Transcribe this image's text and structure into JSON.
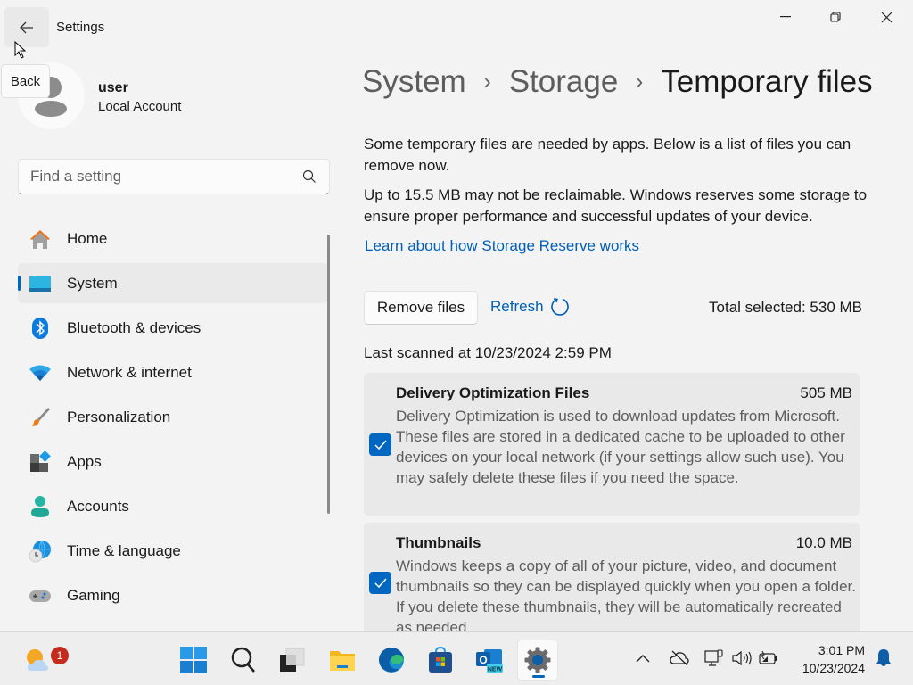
{
  "window": {
    "title": "Settings",
    "back_tooltip": "Back",
    "controls": [
      "minimize",
      "restore",
      "close"
    ]
  },
  "profile": {
    "name": "user",
    "account_type": "Local Account"
  },
  "search": {
    "placeholder": "Find a setting",
    "value": ""
  },
  "nav": {
    "items": [
      {
        "label": "Home",
        "icon": "home-icon"
      },
      {
        "label": "System",
        "icon": "system-icon",
        "active": true
      },
      {
        "label": "Bluetooth & devices",
        "icon": "bluetooth-icon"
      },
      {
        "label": "Network & internet",
        "icon": "wifi-icon"
      },
      {
        "label": "Personalization",
        "icon": "paintbrush-icon"
      },
      {
        "label": "Apps",
        "icon": "apps-icon"
      },
      {
        "label": "Accounts",
        "icon": "accounts-icon"
      },
      {
        "label": "Time & language",
        "icon": "time-language-icon"
      },
      {
        "label": "Gaming",
        "icon": "gaming-icon"
      }
    ]
  },
  "breadcrumb": {
    "items": [
      "System",
      "Storage"
    ],
    "current": "Temporary files",
    "separator": "›"
  },
  "main": {
    "intro": "Some temporary files are needed by apps. Below is a list of files you can remove now.",
    "reserve_note": "Up to 15.5 MB may not be reclaimable. Windows reserves some storage to ensure proper performance and successful updates of your device.",
    "reserve_link": "Learn about how Storage Reserve works",
    "remove_button": "Remove files",
    "refresh_button": "Refresh",
    "total_selected": "Total selected: 530 MB",
    "last_scanned": "Last scanned at 10/23/2024 2:59 PM",
    "categories": [
      {
        "title": "Delivery Optimization Files",
        "size": "505 MB",
        "checked": true,
        "description": "Delivery Optimization is used to download updates from Microsoft. These files are stored in a dedicated cache to be uploaded to other devices on your local network (if your settings allow such use). You may safely delete these files if you need the space."
      },
      {
        "title": "Thumbnails",
        "size": "10.0 MB",
        "checked": true,
        "description": "Windows keeps a copy of all of your picture, video, and document thumbnails so they can be displayed quickly when you open a folder. If you delete these thumbnails, they will be automatically recreated as needed."
      }
    ]
  },
  "taskbar": {
    "weather_badge": "1",
    "apps": [
      "start",
      "search",
      "task-view",
      "file-explorer",
      "edge",
      "store",
      "outlook-new",
      "settings"
    ],
    "active_app": "settings",
    "tray": [
      "show-hidden-icons",
      "onedrive-offline",
      "network",
      "volume",
      "battery"
    ],
    "time": "3:01 PM",
    "date": "10/23/2024"
  },
  "colors": {
    "accent": "#0067c0",
    "link": "#005fb8",
    "background": "#f3f3f3",
    "card": "#e9e9e9"
  }
}
